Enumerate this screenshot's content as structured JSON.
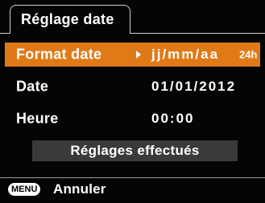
{
  "header": {
    "title": "Réglage date"
  },
  "settings": [
    {
      "label": "Format date",
      "value": "jj/mm/aa",
      "suffix": "24h",
      "selected": true
    },
    {
      "label": "Date",
      "value": "01/01/2012"
    },
    {
      "label": "Heure",
      "value": "00:00"
    }
  ],
  "confirm": {
    "label": "Réglages effectués"
  },
  "footer": {
    "menu_badge": "MENU",
    "action_label": "Annuler"
  },
  "colors": {
    "highlight": "#e07a16",
    "background": "#050505",
    "button": "#3a3a3a"
  }
}
